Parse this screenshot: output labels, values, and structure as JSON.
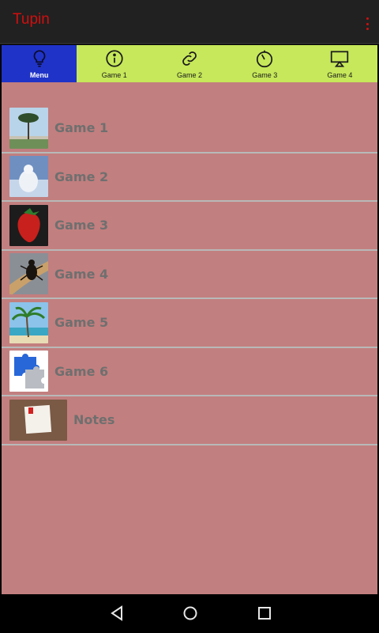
{
  "app": {
    "title": "Tupin"
  },
  "tabs": [
    {
      "label": "Menu",
      "icon": "lightbulb-icon",
      "active": true
    },
    {
      "label": "Game 1",
      "icon": "info-icon"
    },
    {
      "label": "Game 2",
      "icon": "link-icon"
    },
    {
      "label": "Game 3",
      "icon": "timer-icon"
    },
    {
      "label": "Game 4",
      "icon": "cast-icon"
    }
  ],
  "list": {
    "items": [
      {
        "label": "Game 1",
        "thumb": "tree-photo"
      },
      {
        "label": "Game 2",
        "thumb": "polar-bear-photo"
      },
      {
        "label": "Game 3",
        "thumb": "strawberry-photo"
      },
      {
        "label": "Game 4",
        "thumb": "beetle-photo"
      },
      {
        "label": "Game 5",
        "thumb": "palm-beach-photo"
      },
      {
        "label": "Game 6",
        "thumb": "puzzle-photo"
      },
      {
        "label": "Notes",
        "thumb": "note-photo"
      }
    ]
  },
  "navbar": {
    "back": "back-icon",
    "home": "home-icon",
    "recents": "recents-icon"
  },
  "colors": {
    "appbar": "#212121",
    "title": "#d10f0f",
    "tab_bg": "#c6e85a",
    "tab_active": "#2033c8",
    "content_bg": "#c27f7f"
  }
}
